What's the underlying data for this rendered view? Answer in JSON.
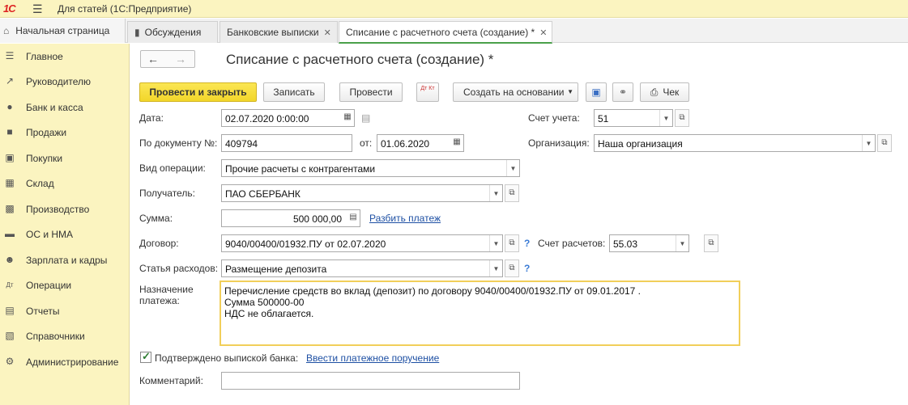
{
  "app": {
    "logo": "1С",
    "title": "Для статей  (1С:Предприятие)"
  },
  "tabs": {
    "home": "Начальная страница",
    "items": [
      {
        "label": "Обсуждения"
      },
      {
        "label": "Банковские выписки"
      },
      {
        "label": "Списание с расчетного счета (создание) *"
      }
    ]
  },
  "sidebar": {
    "items": [
      {
        "label": "Главное",
        "icon": "menu-icon"
      },
      {
        "label": "Руководителю",
        "icon": "trend-icon"
      },
      {
        "label": "Банк и касса",
        "icon": "coin-icon"
      },
      {
        "label": "Продажи",
        "icon": "bag-icon"
      },
      {
        "label": "Покупки",
        "icon": "cart-icon"
      },
      {
        "label": "Склад",
        "icon": "grid-icon"
      },
      {
        "label": "Производство",
        "icon": "factory-icon"
      },
      {
        "label": "ОС и НМА",
        "icon": "truck-icon"
      },
      {
        "label": "Зарплата и кадры",
        "icon": "person-icon"
      },
      {
        "label": "Операции",
        "icon": "dtkt-icon"
      },
      {
        "label": "Отчеты",
        "icon": "chart-icon"
      },
      {
        "label": "Справочники",
        "icon": "book-icon"
      },
      {
        "label": "Администрирование",
        "icon": "gear-icon"
      }
    ]
  },
  "form": {
    "title": "Списание с расчетного счета (создание) *",
    "toolbar": {
      "post_close": "Провести и закрыть",
      "save": "Записать",
      "post": "Провести",
      "dtkt": "Дт Кт",
      "create_based": "Создать на основании",
      "check": "Чек"
    },
    "date": {
      "label": "Дата:",
      "value": "02.07.2020  0:00:00"
    },
    "account": {
      "label": "Счет учета:",
      "value": "51"
    },
    "doc_number": {
      "label": "По документу №:",
      "value": "409794",
      "from_label": "от:",
      "from_value": "01.06.2020"
    },
    "organization": {
      "label": "Организация:",
      "value": "Наша организация"
    },
    "operation": {
      "label": "Вид операции:",
      "value": "Прочие расчеты с контрагентами"
    },
    "recipient": {
      "label": "Получатель:",
      "value": "ПАО СБЕРБАНК"
    },
    "amount": {
      "label": "Сумма:",
      "value": "500 000,00",
      "split_link": "Разбить платеж"
    },
    "contract": {
      "label": "Договор:",
      "value": "9040/00400/01932.ПУ от 02.07.2020",
      "help": "?"
    },
    "settlement_account": {
      "label": "Счет расчетов:",
      "value": "55.03"
    },
    "expense_item": {
      "label": "Статья расходов:",
      "value": "Размещение депозита",
      "help": "?"
    },
    "purpose": {
      "label_line1": "Назначение",
      "label_line2": "платежа:",
      "lines": [
        "Перечисление средств во вклад (депозит) по договору  9040/00400/01932.ПУ от 09.01.2017 .",
        "Сумма 500000-00",
        "НДС не облагается."
      ]
    },
    "confirmed": {
      "label": "Подтверждено выпиской банка:",
      "checked": true,
      "link": "Ввести платежное поручение"
    },
    "comment": {
      "label": "Комментарий:",
      "value": ""
    }
  }
}
